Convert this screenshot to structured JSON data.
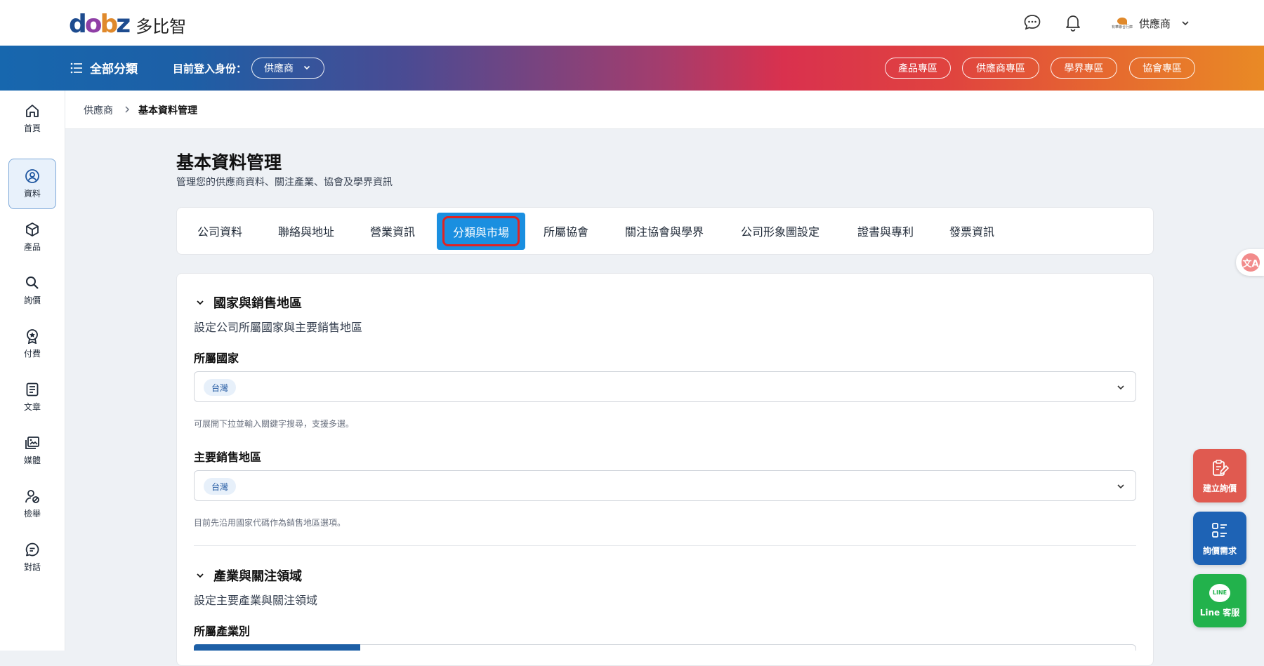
{
  "brand": {
    "name": "多比智"
  },
  "header": {
    "user_name": "供應商",
    "user_org": "有華聯合行庫"
  },
  "banner": {
    "category_label": "全部分類",
    "login_label": "目前登入身份：",
    "role_value": "供應商",
    "zones": [
      "產品專區",
      "供應商專區",
      "學界專區",
      "協會專區"
    ]
  },
  "sidebar": {
    "items": [
      {
        "label": "首頁",
        "icon": "home-icon"
      },
      {
        "label": "資料",
        "icon": "user-circle-icon",
        "active": true
      },
      {
        "label": "產品",
        "icon": "box-icon"
      },
      {
        "label": "詢價",
        "icon": "search-icon"
      },
      {
        "label": "付費",
        "icon": "award-icon"
      },
      {
        "label": "文章",
        "icon": "document-icon"
      },
      {
        "label": "媒體",
        "icon": "media-icon"
      },
      {
        "label": "檢舉",
        "icon": "report-user-icon"
      },
      {
        "label": "對話",
        "icon": "chat-icon"
      }
    ]
  },
  "breadcrumb": {
    "root": "供應商",
    "current": "基本資料管理"
  },
  "page": {
    "title": "基本資料管理",
    "description": "管理您的供應商資料、關注產業、協會及學界資訊"
  },
  "tabs": [
    "公司資料",
    "聯絡與地址",
    "營業資訊",
    "分類與市場",
    "所屬協會",
    "關注協會與學界",
    "公司形象圖設定",
    "證書與專利",
    "發票資訊"
  ],
  "active_tab": "分類與市場",
  "sections": {
    "region": {
      "title": "國家與銷售地區",
      "description": "設定公司所屬國家與主要銷售地區",
      "country_label": "所屬國家",
      "country_value": "台灣",
      "country_hint": "可展開下拉並輸入關鍵字搜尋，支援多選。",
      "sales_label": "主要銷售地區",
      "sales_value": "台灣",
      "sales_hint": "目前先沿用國家代碼作為銷售地區選項。"
    },
    "industry": {
      "title": "產業與關注領域",
      "description": "設定主要產業與關注領域",
      "industry_label": "所屬產業別"
    }
  },
  "floating": {
    "create_inquiry": "建立詢價",
    "inquiry_needs": "詢價需求",
    "line_support": "Line 客服",
    "line_badge": "LINE",
    "translate_glyph": "文A"
  },
  "colors": {
    "primary": "#1a8fe0",
    "create_inquiry_bg": "#e05a50",
    "inquiry_needs_bg": "#1e63b5",
    "line_bg": "#22b24c",
    "highlight_ring": "#e02323"
  }
}
